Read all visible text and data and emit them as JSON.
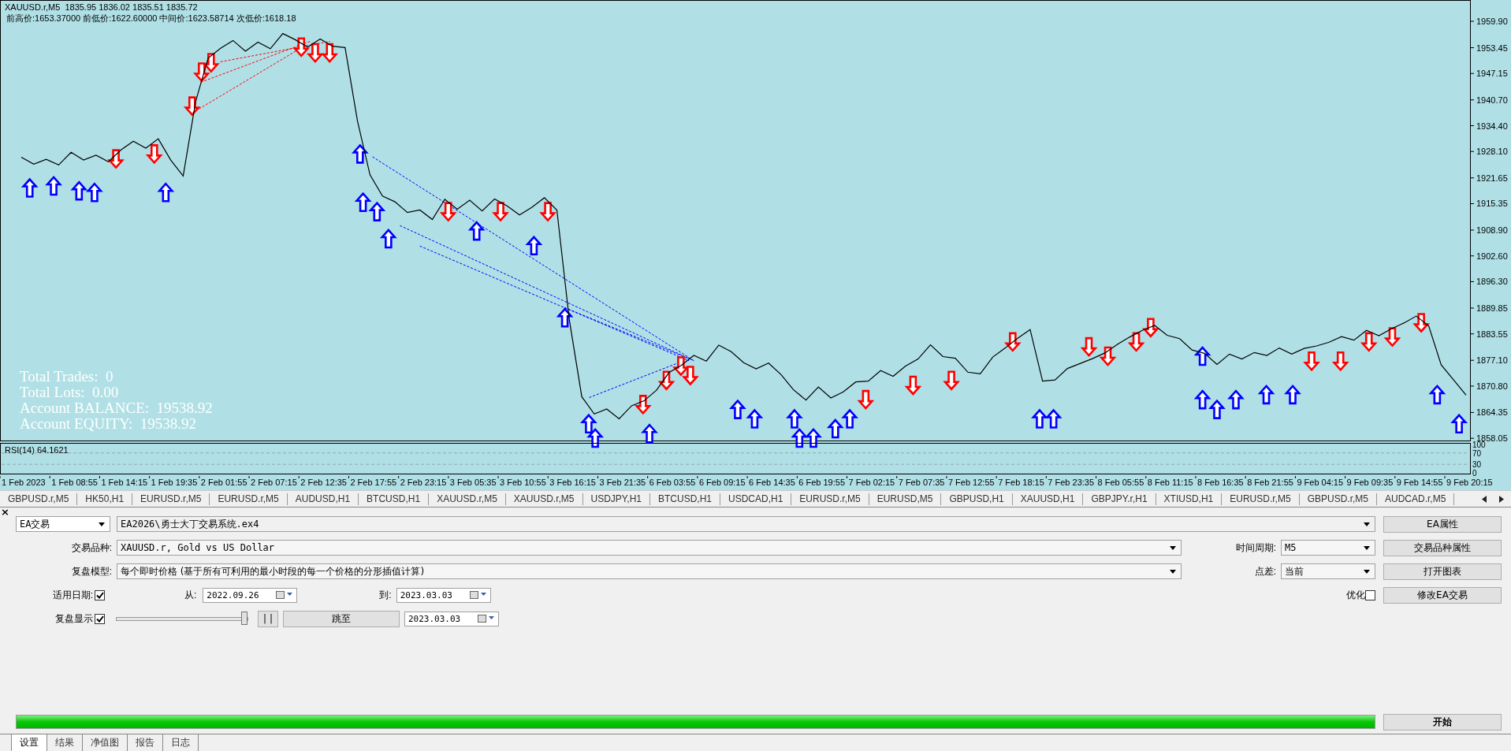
{
  "chart": {
    "symbol_header": "XAUUSD.r,M5  1835.95 1836.02 1835.51 1835.72",
    "levels_info": "前高价:1653.37000 前低价:1622.60000 中间价:1623.58714 次低价:1618.18",
    "stats": [
      "Total Trades:  0",
      "Total Lots:  0.00",
      "Account BALANCE:  19538.92",
      "Account EQUITY:  19538.92"
    ],
    "chart_data": {
      "type": "line",
      "ylim": [
        1857.7,
        1965.1
      ],
      "categories": [
        "1 Feb 2023",
        null,
        null,
        null,
        "1 Feb 08:55",
        null,
        null,
        null,
        "1 Feb 14:15",
        null,
        null,
        null,
        "1 Feb 19:35",
        null,
        null,
        null,
        "2 Feb 01:55",
        null,
        null,
        null,
        "2 Feb 07:15",
        null,
        null,
        null,
        "2 Feb 12:35",
        null,
        null,
        null,
        "2 Feb 17:55",
        null,
        null,
        null,
        "2 Feb 23:15",
        null,
        null,
        null,
        "3 Feb 05:35",
        null,
        null,
        null,
        "3 Feb 10:55",
        null,
        null,
        null,
        "3 Feb 16:15",
        null,
        null,
        null,
        "3 Feb 21:35",
        null,
        null,
        null,
        "6 Feb 03:55",
        null,
        null,
        null,
        "6 Feb 09:15",
        null,
        null,
        null,
        "6 Feb 14:35",
        null,
        null,
        null,
        "6 Feb 19:55",
        null,
        null,
        null,
        "7 Feb 02:15",
        null,
        null,
        null,
        "7 Feb 07:35",
        null,
        null,
        null,
        "7 Feb 12:55",
        null,
        null,
        null,
        "7 Feb 18:15",
        null,
        null,
        null,
        "7 Feb 23:35",
        null,
        null,
        null,
        "8 Feb 05:55",
        null,
        null,
        null,
        "8 Feb 11:15",
        null,
        null,
        null,
        "8 Feb 16:35",
        null,
        null,
        null,
        "8 Feb 21:55",
        null,
        null,
        null,
        "9 Feb 04:15",
        null,
        null,
        null,
        "9 Feb 09:35",
        null,
        null,
        null,
        "9 Feb 14:55",
        null,
        null,
        null,
        "9 Feb 20:15"
      ],
      "values": [
        1926.7,
        1925.0,
        1926.2,
        1924.8,
        1927.9,
        1926.0,
        1927.2,
        1925.6,
        1928.5,
        1930.6,
        1928.9,
        1931.2,
        1926.0,
        1922.1,
        1940.3,
        1950.9,
        1953.3,
        1955.2,
        1952.6,
        1954.8,
        1953.2,
        1956.9,
        1955.4,
        1953.6,
        1955.6,
        1953.8,
        1953.5,
        1935.5,
        1922.4,
        1917.2,
        1915.8,
        1913.2,
        1913.8,
        1911.5,
        1916.4,
        1914.0,
        1916.2,
        1913.6,
        1916.5,
        1914.8,
        1912.6,
        1914.5,
        1916.8,
        1913.8,
        1887.0,
        1868.2,
        1864.0,
        1865.2,
        1862.8,
        1866.0,
        1867.2,
        1869.8,
        1874.1,
        1875.9,
        1878.3,
        1876.9,
        1880.8,
        1879.2,
        1876.5,
        1875.0,
        1876.4,
        1873.6,
        1869.9,
        1867.4,
        1870.6,
        1867.9,
        1869.4,
        1871.8,
        1872.0,
        1874.6,
        1873.2,
        1875.7,
        1877.4,
        1880.9,
        1878.0,
        1877.6,
        1874.2,
        1873.8,
        1877.9,
        1880.1,
        1882.5,
        1884.6,
        1872.0,
        1872.3,
        1875.1,
        1876.3,
        1877.5,
        1878.9,
        1881.0,
        1882.8,
        1884.4,
        1885.6,
        1883.2,
        1882.4,
        1879.6,
        1878.8,
        1876.1,
        1878.6,
        1877.4,
        1879.0,
        1878.3,
        1880.1,
        1878.6,
        1880.0,
        1880.6,
        1881.5,
        1882.9,
        1882.0,
        1884.4,
        1883.1,
        1884.8,
        1886.2,
        1887.9,
        1885.5,
        1876.0,
        1872.3,
        1868.6
      ],
      "yticks": [
        {
          "value": 1959.9,
          "label": "1959.90"
        },
        {
          "value": 1953.45,
          "label": "1953.45"
        },
        {
          "value": 1947.15,
          "label": "1947.15"
        },
        {
          "value": 1940.7,
          "label": "1940.70"
        },
        {
          "value": 1934.4,
          "label": "1934.40"
        },
        {
          "value": 1928.1,
          "label": "1928.10"
        },
        {
          "value": 1921.65,
          "label": "1921.65"
        },
        {
          "value": 1915.35,
          "label": "1915.35"
        },
        {
          "value": 1908.9,
          "label": "1908.90"
        },
        {
          "value": 1902.6,
          "label": "1902.60"
        },
        {
          "value": 1896.3,
          "label": "1896.30"
        },
        {
          "value": 1889.85,
          "label": "1889.85"
        },
        {
          "value": 1883.55,
          "label": "1883.55"
        },
        {
          "value": 1877.1,
          "label": "1877.10"
        },
        {
          "value": 1870.8,
          "label": "1870.80"
        },
        {
          "value": 1864.35,
          "label": "1864.35"
        },
        {
          "value": 1858.05,
          "label": "1858.05"
        }
      ]
    },
    "rsi": {
      "label": "RSI(14) 64.1621",
      "levels": [
        "100",
        "70",
        "30",
        "0"
      ]
    }
  },
  "chart_tabs": [
    "GBPUSD.r,M5",
    "HK50,H1",
    "EURUSD.r,M5",
    "EURUSD.r,M5",
    "AUDUSD,H1",
    "BTCUSD,H1",
    "XAUUSD.r,M5",
    "XAUUSD.r,M5",
    "USDJPY,H1",
    "BTCUSD,H1",
    "USDCAD,H1",
    "EURUSD.r,M5",
    "EURUSD,M5",
    "GBPUSD,H1",
    "XAUUSD,H1",
    "GBPJPY.r,H1",
    "XTIUSD,H1",
    "EURUSD.r,M5",
    "GBPUSD.r,M5",
    "AUDCAD.r,M5"
  ],
  "tester": {
    "close": "×",
    "expert_type": "EA交易",
    "expert": "EA2026\\勇士大丁交易系统.ex4",
    "symbol_label": "交易品种:",
    "symbol": "XAUUSD.r, Gold vs US Dollar",
    "period_label": "时间周期:",
    "period": "M5",
    "model_label": "复盘模型:",
    "model": "每个即时价格 (基于所有可利用的最小时段的每一个价格的分形插值计算)",
    "spread_label": "点差:",
    "spread": "当前",
    "use_date": {
      "label": "适用日期:",
      "checked": true
    },
    "from_label": "从:",
    "from": "2022.09.26",
    "to_label": "到:",
    "to": "2023.03.03",
    "optimization": {
      "label": "优化",
      "checked": false
    },
    "visual": {
      "label": "复盘显示",
      "checked": true
    },
    "speed": {
      "level": 1
    },
    "pause": "| |",
    "skip_to": "跳至",
    "skip_date": "2023.03.03",
    "buttons": [
      "EA属性",
      "交易品种属性",
      "打开图表",
      "修改EA交易"
    ],
    "progress": {
      "level": 1
    },
    "start": "开始"
  },
  "bottom_tabs": [
    {
      "label": "设置",
      "selected": true
    },
    {
      "label": "结果",
      "selected": false
    },
    {
      "label": "净值图",
      "selected": false
    },
    {
      "label": "报告",
      "selected": false
    },
    {
      "label": "日志",
      "selected": false
    }
  ]
}
